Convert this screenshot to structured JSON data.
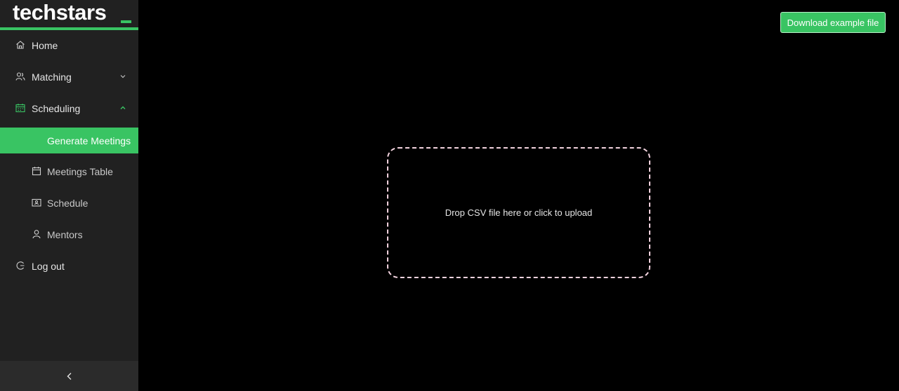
{
  "sidebar": {
    "logo": "techstars",
    "items": [
      {
        "label": "Home",
        "icon": "home-icon"
      },
      {
        "label": "Matching",
        "icon": "users-icon",
        "expanded": false
      },
      {
        "label": "Scheduling",
        "icon": "calendar-icon",
        "expanded": true
      },
      {
        "label": "Generate Meetings",
        "active": true
      },
      {
        "label": "Meetings Table",
        "icon": "calendar-icon"
      },
      {
        "label": "Schedule",
        "icon": "contact-card-icon"
      },
      {
        "label": "Mentors",
        "icon": "user-icon"
      },
      {
        "label": "Log out",
        "icon": "logout-icon"
      }
    ],
    "collapse_icon": "chevron-left-icon"
  },
  "main": {
    "download_label": "Download example file",
    "dropzone_text": "Drop CSV file here or click to upload"
  },
  "colors": {
    "accent": "#39c463",
    "sidebar_bg": "#212121",
    "page_bg": "#000000"
  }
}
